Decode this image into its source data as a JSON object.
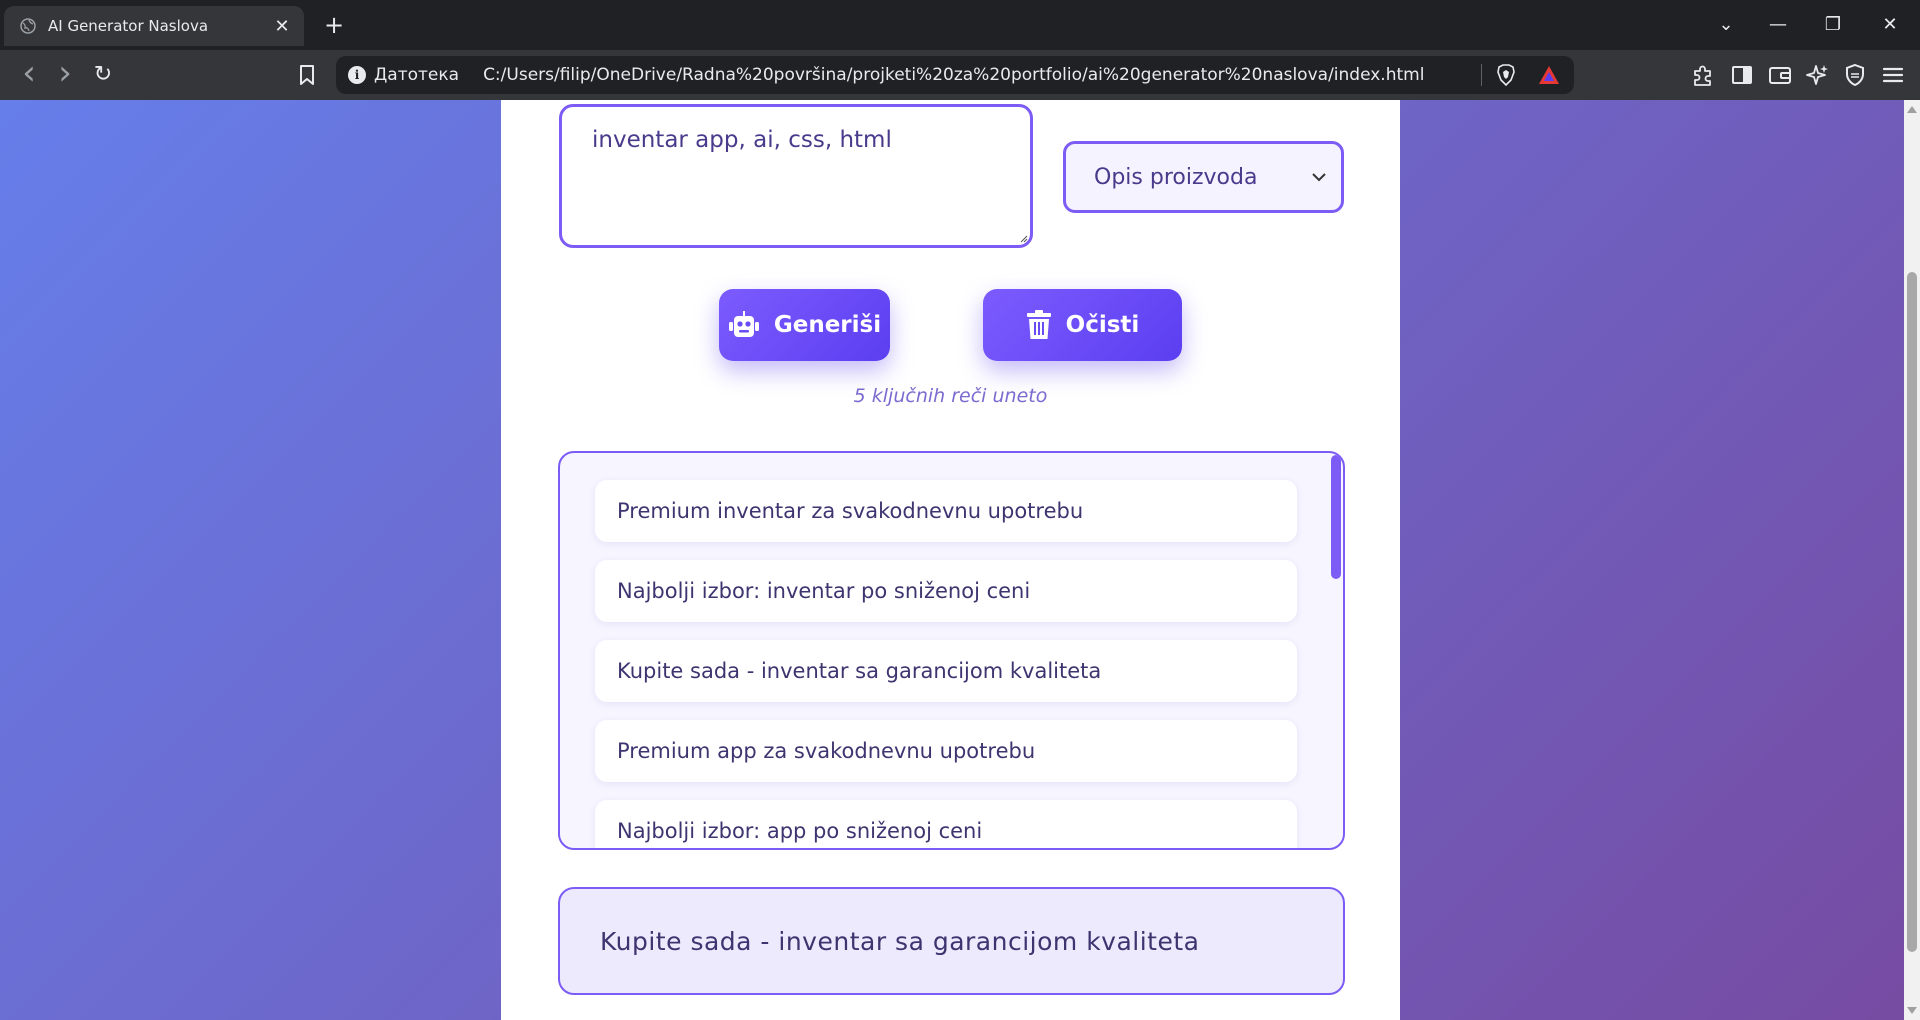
{
  "browser": {
    "tab_title": "AI Generator Naslova",
    "tab_close": "✕",
    "new_tab": "+",
    "scheme_label": "Датотека",
    "url": "C:/Users/filip/OneDrive/Radna%20površina/projketi%20za%20portfolio/ai%20generator%20naslova/index.html",
    "window_controls": {
      "tabs_menu": "⌄",
      "minimize": "—",
      "restore": "❐",
      "close": "✕"
    },
    "nav": {
      "back": "‹",
      "forward": "›",
      "reload": "↻"
    }
  },
  "page": {
    "keywords_value": "inventar app, ai, css, html",
    "type_select": "Opis proizvoda",
    "generate_label": "Generiši",
    "clear_label": "Očisti",
    "keyword_count": "5 ključnih reči uneto",
    "results": [
      "Premium inventar za svakodnevnu upotrebu",
      "Najbolji izbor: inventar po sniženoj ceni",
      "Kupite sada - inventar sa garancijom kvaliteta",
      "Premium app za svakodnevnu upotrebu",
      "Najbolji izbor: app po sniženoj ceni"
    ],
    "selected_result": "Kupite sada - inventar sa garancijom kvaliteta"
  },
  "colors": {
    "accent": "#7c5cf5",
    "button_gradient_start": "#7c5cff",
    "button_gradient_end": "#5b3ef0",
    "background_gradient_start": "#667eea",
    "background_gradient_end": "#764ba2"
  }
}
